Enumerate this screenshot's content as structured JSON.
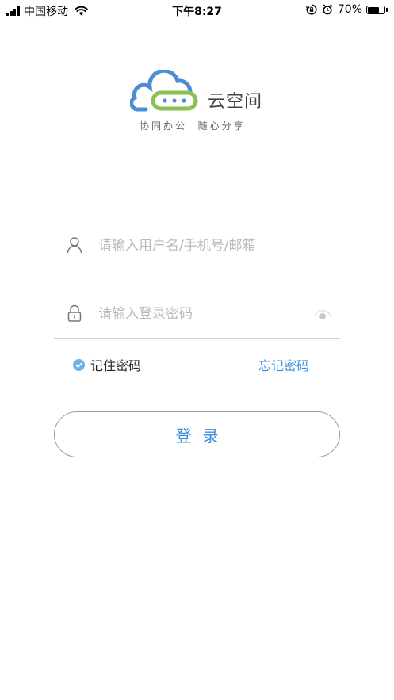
{
  "status_bar": {
    "carrier": "中国移动",
    "time": "下午8:27",
    "battery_percent": "70%",
    "battery_level": 0.7,
    "icons": [
      "signal-icon",
      "wifi-icon",
      "rotation-lock-icon",
      "alarm-icon",
      "battery-icon"
    ]
  },
  "logo": {
    "name": "云空间",
    "tagline": "协同办公  随心分享",
    "colors": {
      "cloud_blue": "#4a8fd4",
      "cloud_green": "#8cc152"
    }
  },
  "login_form": {
    "username_placeholder": "请输入用户名/手机号/邮箱",
    "username_value": "",
    "password_placeholder": "请输入登录密码",
    "password_value": "",
    "remember_label": "记住密码",
    "remember_checked": true,
    "forgot_label": "忘记密码",
    "login_label": "登录"
  },
  "colors": {
    "accent": "#3a8fdc",
    "checkbox": "#6cb2ea",
    "placeholder": "#b9b9bf",
    "divider": "#cfcfcf"
  }
}
